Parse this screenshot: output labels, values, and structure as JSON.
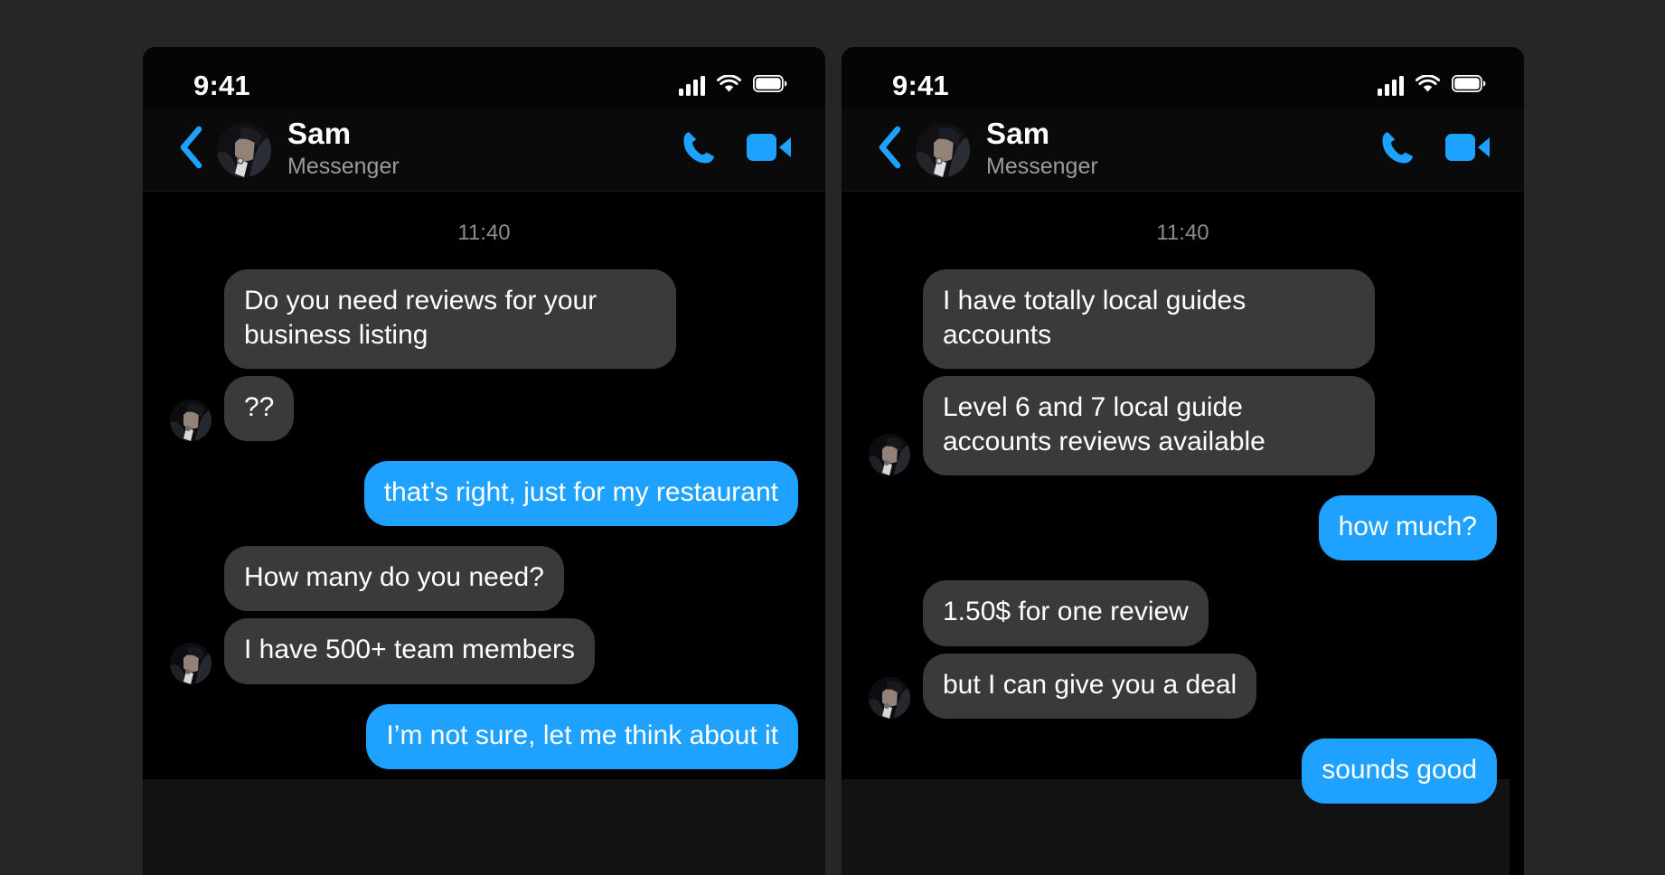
{
  "page": {
    "background_color": "#262626",
    "card_background": "#0a0a0a",
    "accent_color": "#1fa2ff",
    "incoming_bubble_color": "#3a3a3c",
    "outgoing_bubble_color": "#1fa2ff"
  },
  "panels": [
    {
      "id": "left",
      "status_bar": {
        "time": "9:41",
        "signal_icon": "cellular-signal-icon",
        "wifi_icon": "wifi-icon",
        "battery_icon": "battery-full-icon"
      },
      "header": {
        "back_icon": "back-chevron-icon",
        "avatar": "contact-avatar",
        "name": "Sam",
        "subtitle": "Messenger",
        "call_icon": "phone-call-icon",
        "video_icon": "video-call-icon"
      },
      "conversation": {
        "timestamp": "11:40",
        "messages": [
          {
            "side": "in",
            "text": "Do you need reviews for your business listing",
            "avatar": false
          },
          {
            "side": "in",
            "text": "??",
            "avatar": true
          },
          {
            "side": "out",
            "text": "that’s right, just for my restaurant",
            "avatar": false
          },
          {
            "side": "in",
            "text": "How many do you need?",
            "avatar": false
          },
          {
            "side": "in",
            "text": "I have 500+ team members",
            "avatar": true
          },
          {
            "side": "out",
            "text": "I’m not sure, let me think about it",
            "avatar": false
          }
        ]
      }
    },
    {
      "id": "right",
      "status_bar": {
        "time": "9:41",
        "signal_icon": "cellular-signal-icon",
        "wifi_icon": "wifi-icon",
        "battery_icon": "battery-full-icon"
      },
      "header": {
        "back_icon": "back-chevron-icon",
        "avatar": "contact-avatar",
        "name": "Sam",
        "subtitle": "Messenger",
        "call_icon": "phone-call-icon",
        "video_icon": "video-call-icon"
      },
      "conversation": {
        "timestamp": "11:40",
        "messages": [
          {
            "side": "in",
            "text": "I have totally local guides accounts",
            "avatar": false
          },
          {
            "side": "in",
            "text": "Level 6 and 7 local guide accounts reviews available",
            "avatar": true
          },
          {
            "side": "out",
            "text": "how much?",
            "avatar": false
          },
          {
            "side": "in",
            "text": "1.50$ for one review",
            "avatar": false
          },
          {
            "side": "in",
            "text": "but I can give you a deal",
            "avatar": true
          },
          {
            "side": "out",
            "text": "sounds good",
            "avatar": false
          }
        ]
      }
    }
  ]
}
